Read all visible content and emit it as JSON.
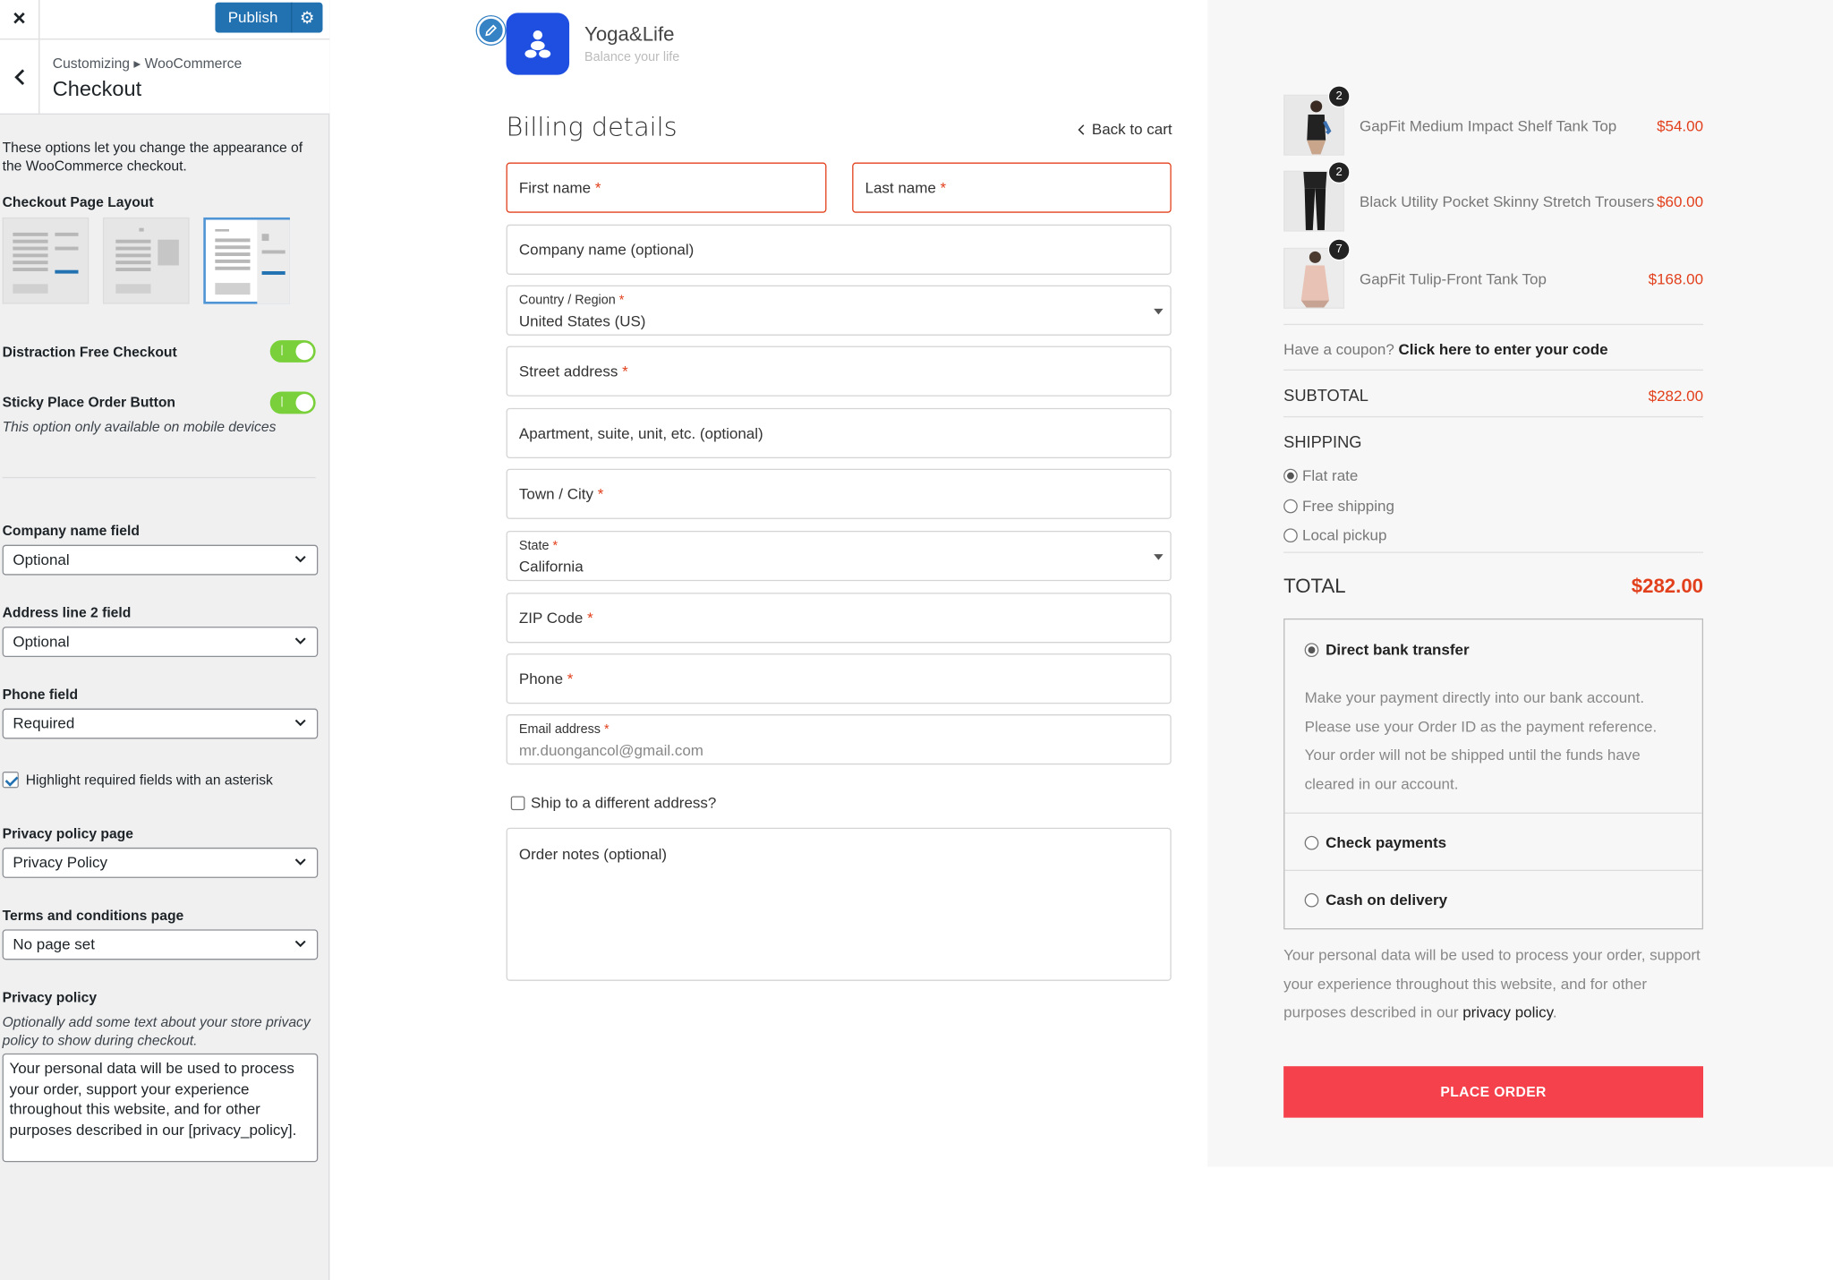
{
  "customizer": {
    "close_label": "×",
    "publish_label": "Publish",
    "breadcrumb": "Customizing ▸ WooCommerce",
    "section_title": "Checkout",
    "description": "These options let you change the appearance of the WooCommerce checkout.",
    "layout_label": "Checkout Page Layout",
    "layouts": [
      "layout-1",
      "layout-2",
      "layout-3"
    ],
    "selected_layout": 2,
    "distraction_free_label": "Distraction Free Checkout",
    "distraction_free_on": true,
    "sticky_label": "Sticky Place Order Button",
    "sticky_on": true,
    "sticky_note": "This option only available on mobile devices",
    "company_field_label": "Company name field",
    "company_field_value": "Optional",
    "address2_field_label": "Address line 2 field",
    "address2_field_value": "Optional",
    "phone_field_label": "Phone field",
    "phone_field_value": "Required",
    "highlight_label": "Highlight required fields with an asterisk",
    "highlight_checked": true,
    "privacy_page_label": "Privacy policy page",
    "privacy_page_value": "Privacy Policy",
    "terms_page_label": "Terms and conditions page",
    "terms_page_value": "No page set",
    "privacy_policy_label": "Privacy policy",
    "privacy_policy_note": "Optionally add some text about your store privacy policy to show during checkout.",
    "privacy_policy_text": "Your personal data will be used to process your order, support your experience throughout this website, and for other purposes described in our [privacy_policy]."
  },
  "store": {
    "name": "Yoga&Life",
    "tagline": "Balance your life",
    "accent": "#f5414b",
    "logo_color": "#1f4fe0"
  },
  "billing": {
    "title": "Billing details",
    "back_to_cart": "Back to cart",
    "first_name": "First name",
    "last_name": "Last name",
    "company": "Company name (optional)",
    "country_label": "Country / Region",
    "country_value": "United States (US)",
    "street": "Street address",
    "apartment": "Apartment, suite, unit, etc. (optional)",
    "city": "Town / City",
    "state_label": "State",
    "state_value": "California",
    "zip": "ZIP Code",
    "phone": "Phone",
    "email_label": "Email address",
    "email_placeholder": "mr.duongancol@gmail.com",
    "ship_different": "Ship to a different address?",
    "order_notes": "Order notes (optional)",
    "asterisk": "*"
  },
  "order": {
    "items": [
      {
        "name": "GapFit Medium Impact Shelf Tank Top",
        "qty": "2",
        "price": "$54.00"
      },
      {
        "name": "Black Utility Pocket Skinny Stretch Trousers",
        "qty": "2",
        "price": "$60.00"
      },
      {
        "name": "GapFit Tulip-Front Tank Top",
        "qty": "7",
        "price": "$168.00"
      }
    ],
    "coupon_prompt": "Have a coupon?",
    "coupon_link": "Click here to enter your code",
    "subtotal_label": "SUBTOTAL",
    "subtotal_value": "$282.00",
    "shipping_label": "SHIPPING",
    "shipping_options": [
      "Flat rate",
      "Free shipping",
      "Local pickup"
    ],
    "shipping_selected": 0,
    "total_label": "TOTAL",
    "total_value": "$282.00",
    "payments": {
      "bank": "Direct bank transfer",
      "bank_desc": "Make your payment directly into our bank account. Please use your Order ID as the payment reference. Your order will not be shipped until the funds have cleared in our account.",
      "check": "Check payments",
      "cod": "Cash on delivery"
    },
    "privacy_text": "Your personal data will be used to process your order, support your experience throughout this website, and for other purposes described in our",
    "privacy_link": "privacy policy",
    "privacy_end": ".",
    "place_order": "PLACE ORDER"
  }
}
